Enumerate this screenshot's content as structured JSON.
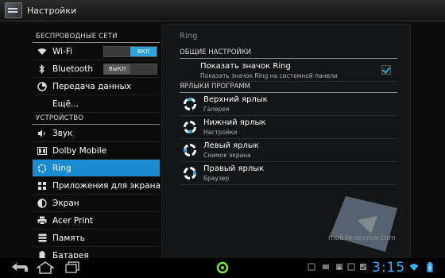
{
  "app": {
    "title": "Настройки"
  },
  "sidebar": {
    "sections": {
      "wireless": "БЕСПРОВОДНЫЕ СЕТИ",
      "device": "УСТРОЙСТВО"
    },
    "wireless_items": [
      {
        "label": "Wi-Fi",
        "icon": "wifi-icon",
        "toggle": "ВКЛ"
      },
      {
        "label": "Bluetooth",
        "icon": "bluetooth-icon",
        "toggle": "ВЫКЛ"
      },
      {
        "label": "Передача данных",
        "icon": "data-usage-icon"
      },
      {
        "label": "Ещё..."
      }
    ],
    "device_items": [
      {
        "label": "Звук",
        "icon": "sound-icon"
      },
      {
        "label": "Dolby Mobile",
        "icon": "dolby-icon"
      },
      {
        "label": "Ring",
        "icon": "ring-icon"
      },
      {
        "label": "Приложения для экрана блокировки",
        "icon": "lockscreen-apps-icon"
      },
      {
        "label": "Экран",
        "icon": "display-icon"
      },
      {
        "label": "Acer Print",
        "icon": "printer-icon"
      },
      {
        "label": "Память",
        "icon": "storage-icon"
      },
      {
        "label": "Батарея",
        "icon": "battery-icon"
      }
    ]
  },
  "detail": {
    "title": "Ring",
    "general_header": "ОБЩИЕ НАСТРОЙКИ",
    "show_ring": {
      "title": "Показать значок Ring",
      "summary": "Показать значок Ring на системной панели",
      "checked": true
    },
    "shortcuts_header": "ЯРЛЫКИ ПРОГРАММ",
    "shortcuts": [
      {
        "title": "Верхний ярлык",
        "summary": "Галерея",
        "position": "top"
      },
      {
        "title": "Нижний ярлык",
        "summary": "Настройки",
        "position": "bottom"
      },
      {
        "title": "Левый ярлык",
        "summary": "Снимок экрана",
        "position": "left"
      },
      {
        "title": "Правый ярлык",
        "summary": "Браузер",
        "position": "right"
      }
    ]
  },
  "watermark": "mobile-review.com",
  "statusbar": {
    "clock": "3:15"
  },
  "colors": {
    "accent": "#1a8bd1",
    "clock": "#3ab0ff",
    "toggle_on": "#2ea3dc"
  }
}
